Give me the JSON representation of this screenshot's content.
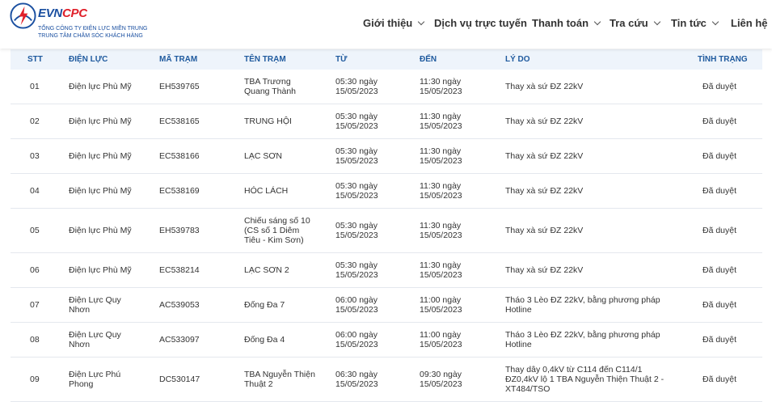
{
  "header": {
    "brand_evn": "EVN",
    "brand_cpc": "CPC",
    "company_line1": "TỔNG CÔNG TY ĐIỆN LỰC MIỀN TRUNG",
    "company_line2": "TRUNG TÂM CHĂM SÓC KHÁCH HÀNG",
    "logo_icon": "evncpc-logo-icon",
    "colors": {
      "brand_blue": "#1a4fa0",
      "brand_red": "#e0202a"
    }
  },
  "nav": [
    {
      "label": "Giới thiệu",
      "has_dropdown": true
    },
    {
      "label": "Dịch vụ trực tuyến",
      "has_dropdown": false
    },
    {
      "label": "Thanh toán",
      "has_dropdown": true
    },
    {
      "label": "Tra cứu",
      "has_dropdown": true
    },
    {
      "label": "Tin tức",
      "has_dropdown": true
    },
    {
      "label": "Liên hệ",
      "has_dropdown": false
    }
  ],
  "table": {
    "header_color": "#1f5a9e",
    "columns": [
      "STT",
      "Điện lực",
      "Mã trạm",
      "Tên trạm",
      "Từ",
      "Đến",
      "Lý do",
      "Tình trạng"
    ],
    "rows": [
      {
        "stt": "01",
        "dien_luc": [
          "Điện lực Phù Mỹ"
        ],
        "ma_tram": "EH539765",
        "ten_tram": [
          "TBA Trương",
          "Quang Thành"
        ],
        "tu": [
          "05:30 ngày",
          "15/05/2023"
        ],
        "den": [
          "11:30 ngày",
          "15/05/2023"
        ],
        "ly_do": [
          "Thay xà sứ ĐZ 22kV"
        ],
        "tinh_trang": "Đã duyệt"
      },
      {
        "stt": "02",
        "dien_luc": [
          "Điện lực Phù Mỹ"
        ],
        "ma_tram": "EC538165",
        "ten_tram": [
          "TRUNG HỘI"
        ],
        "tu": [
          "05:30 ngày",
          "15/05/2023"
        ],
        "den": [
          "11:30 ngày",
          "15/05/2023"
        ],
        "ly_do": [
          "Thay xà sứ ĐZ 22kV"
        ],
        "tinh_trang": "Đã duyệt"
      },
      {
        "stt": "03",
        "dien_luc": [
          "Điện lực Phù Mỹ"
        ],
        "ma_tram": "EC538166",
        "ten_tram": [
          "LẠC SƠN"
        ],
        "tu": [
          "05:30 ngày",
          "15/05/2023"
        ],
        "den": [
          "11:30 ngày",
          "15/05/2023"
        ],
        "ly_do": [
          "Thay xà sứ ĐZ 22kV"
        ],
        "tinh_trang": "Đã duyệt"
      },
      {
        "stt": "04",
        "dien_luc": [
          "Điện lực Phù Mỹ"
        ],
        "ma_tram": "EC538169",
        "ten_tram": [
          "HÓC LÁCH"
        ],
        "tu": [
          "05:30 ngày",
          "15/05/2023"
        ],
        "den": [
          "11:30 ngày",
          "15/05/2023"
        ],
        "ly_do": [
          "Thay xà sứ ĐZ 22kV"
        ],
        "tinh_trang": "Đã duyệt"
      },
      {
        "stt": "05",
        "dien_luc": [
          "Điện lực Phù Mỹ"
        ],
        "ma_tram": "EH539783",
        "ten_tram": [
          "Chiếu sáng số 10",
          "(CS số 1 Diêm",
          "Tiêu - Kim Sơn)"
        ],
        "tu": [
          "05:30 ngày",
          "15/05/2023"
        ],
        "den": [
          "11:30 ngày",
          "15/05/2023"
        ],
        "ly_do": [
          "Thay xà sứ ĐZ 22kV"
        ],
        "tinh_trang": "Đã duyệt"
      },
      {
        "stt": "06",
        "dien_luc": [
          "Điện lực Phù Mỹ"
        ],
        "ma_tram": "EC538214",
        "ten_tram": [
          "LẠC SƠN 2"
        ],
        "tu": [
          "05:30 ngày",
          "15/05/2023"
        ],
        "den": [
          "11:30 ngày",
          "15/05/2023"
        ],
        "ly_do": [
          "Thay xà sứ ĐZ 22kV"
        ],
        "tinh_trang": "Đã duyệt"
      },
      {
        "stt": "07",
        "dien_luc": [
          "Điện Lực Quy",
          "Nhơn"
        ],
        "ma_tram": "AC539053",
        "ten_tram": [
          "Đống Đa 7"
        ],
        "tu": [
          "06:00 ngày",
          "15/05/2023"
        ],
        "den": [
          "11:00 ngày",
          "15/05/2023"
        ],
        "ly_do": [
          "Tháo 3 Lèo ĐZ 22kV, bằng phương pháp",
          "Hotline"
        ],
        "tinh_trang": "Đã duyệt"
      },
      {
        "stt": "08",
        "dien_luc": [
          "Điện Lực Quy",
          "Nhơn"
        ],
        "ma_tram": "AC533097",
        "ten_tram": [
          "Đống Đa 4"
        ],
        "tu": [
          "06:00 ngày",
          "15/05/2023"
        ],
        "den": [
          "11:00 ngày",
          "15/05/2023"
        ],
        "ly_do": [
          "Tháo 3 Lèo ĐZ 22kV, bằng phương pháp",
          "Hotline"
        ],
        "tinh_trang": "Đã duyệt"
      },
      {
        "stt": "09",
        "dien_luc": [
          "Điện Lực Phú",
          "Phong"
        ],
        "ma_tram": "DC530147",
        "ten_tram": [
          "TBA Nguyễn Thiện",
          "Thuật 2"
        ],
        "tu": [
          "06:30 ngày",
          "15/05/2023"
        ],
        "den": [
          "09:30 ngày",
          "15/05/2023"
        ],
        "ly_do": [
          "Thay dây 0,4kV từ C114 đến C114/1",
          "ĐZ0,4kV lộ 1 TBA Nguyễn Thiện Thuật 2 -",
          "XT484/TSO"
        ],
        "tinh_trang": "Đã duyệt"
      }
    ]
  }
}
